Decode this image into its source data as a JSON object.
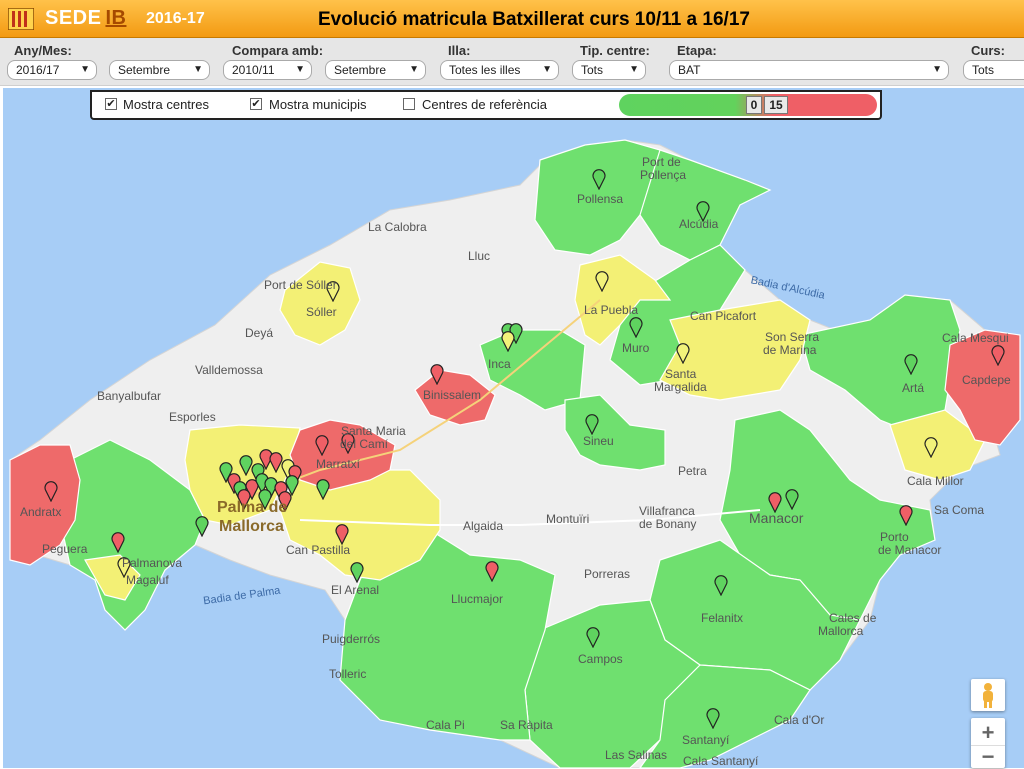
{
  "header": {
    "brand_a": "SEDE",
    "brand_b": "IB",
    "year": "2016-17",
    "title": "Evolució matricula Batxillerat curs 10/11 a 16/17"
  },
  "filters": {
    "any_mes_label": "Any/Mes:",
    "any_value": "2016/17",
    "mes_value": "Setembre",
    "compara_label": "Compara amb:",
    "compara_any": "2010/11",
    "compara_mes": "Setembre",
    "illa_label": "Illa:",
    "illa_value": "Totes les illes",
    "tip_label": "Tip. centre:",
    "tip_value": "Tots",
    "etapa_label": "Etapa:",
    "etapa_value": "BAT",
    "curs_label": "Curs:",
    "curs_value": "Tots"
  },
  "controls": {
    "mostra_centres": "Mostra centres",
    "mostra_municipis": "Mostra municipis",
    "centres_referencia": "Centres de referència",
    "legend_min": "0",
    "legend_max": "15",
    "colors": {
      "low": "#5fd35f",
      "high": "#ef5f66",
      "mid": "#f2f27a"
    }
  },
  "map": {
    "labels": {
      "port_pollenca_a": "Port de",
      "port_pollenca_b": "Pollença",
      "pollensa": "Pollensa",
      "alcudia": "Alcúdia",
      "badia_alcudia": "Badia d'Alcúdia",
      "la_calobra": "La Calobra",
      "lluc": "Lluc",
      "port_soller": "Port de Sóller",
      "soller": "Sóller",
      "la_puebla": "La Puebla",
      "can_picafort": "Can Picafort",
      "son_serra_a": "Son Serra",
      "son_serra_b": "de Marina",
      "cala_mesquida": "Cala Mesqui",
      "deya": "Deyá",
      "muro": "Muro",
      "inca": "Inca",
      "santa_margalida_a": "Santa",
      "santa_margalida_b": "Margalida",
      "arta": "Artá",
      "capdepera": "Capdepe",
      "valldemossa": "Valldemossa",
      "banyalbufar": "Banyalbufar",
      "binissalem": "Binissalem",
      "esporles": "Esporles",
      "santa_maria_a": "Santa Maria",
      "santa_maria_b": "del Camí",
      "sineu": "Sineu",
      "marratxi": "Marratxí",
      "petra": "Petra",
      "cala_millor": "Cala Millor",
      "andratx": "Andratx",
      "palma_a": "Palma de",
      "palma_b": "Mallorca",
      "algaida": "Algaida",
      "montuiri": "Montuïri",
      "vilafranca_a": "Villafranca",
      "vilafranca_b": "de Bonany",
      "manacor": "Manacor",
      "sa_coma": "Sa Coma",
      "peguera": "Peguera",
      "palmanova": "Palmanova",
      "magaluf": "Magaluf",
      "can_pastilla": "Can Pastilla",
      "porto_cristo_a": "Porto",
      "porto_cristo_b": "de Manacor",
      "badia_palma": "Badia de Palma",
      "el_arenal": "El Arenal",
      "llucmajor": "Llucmajor",
      "porreras": "Porreras",
      "felanitx": "Felanitx",
      "cales_a": "Cales de",
      "cales_b": "Mallorca",
      "puigderros": "Puigderrós",
      "campos": "Campos",
      "tolleric": "Tolleric",
      "cala_pi": "Cala Pi",
      "sa_rapita": "Sa Ràpita",
      "santanyi": "Santanyí",
      "cala_dor": "Cala d'Or",
      "las_salinas": "Las Salinas",
      "cala_santanyi": "Cala Santanyí"
    },
    "zoom_in": "+",
    "zoom_out": "−",
    "pegman_icon": "person-icon"
  }
}
